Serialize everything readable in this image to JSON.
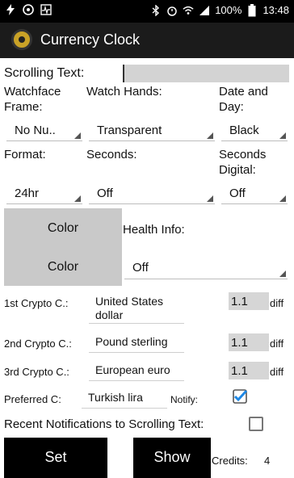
{
  "statusbar": {
    "battery": "100%",
    "time": "13:48",
    "icons": [
      "bolt-icon",
      "whatsapp-icon",
      "activity-icon",
      "bluetooth-icon",
      "alarm-icon",
      "wifi-icon",
      "signal-icon",
      "battery-icon"
    ]
  },
  "appbar": {
    "title": "Currency Clock"
  },
  "scrolling": {
    "label": "Scrolling Text:",
    "value": ""
  },
  "watchface": {
    "label_line1": "Watchface",
    "label_line2": "Frame:",
    "value": "No Nu.."
  },
  "hands": {
    "label": "Watch Hands:",
    "value": "Transparent"
  },
  "dateday": {
    "label_line1": "Date and",
    "label_line2": "Day:",
    "value": "Black"
  },
  "format": {
    "label": "Format:",
    "value": "24hr"
  },
  "seconds": {
    "label": "Seconds:",
    "value": "Off"
  },
  "seconds_digital": {
    "label_line1": "Seconds",
    "label_line2": "Digital:",
    "value": "Off"
  },
  "color": {
    "label1": "Color",
    "label2": "Color"
  },
  "health": {
    "label": "Health Info:",
    "value": "Off"
  },
  "crypto": [
    {
      "label": "1st Crypto C.:",
      "currency_line1": "United States",
      "currency_line2": "dollar",
      "diff_value": "1.1",
      "diff_label": "diff"
    },
    {
      "label": "2nd Crypto C.:",
      "currency_line1": "Pound sterling",
      "currency_line2": "",
      "diff_value": "1.1",
      "diff_label": "diff"
    },
    {
      "label": "3rd Crypto C.:",
      "currency_line1": "European euro",
      "currency_line2": "",
      "diff_value": "1.1",
      "diff_label": "diff"
    }
  ],
  "preferred": {
    "label": "Preferred C:",
    "value": "Turkish lira",
    "notify_label": "Notify:",
    "notify_checked": true
  },
  "recent": {
    "label": "Recent Notifications to Scrolling Text:",
    "checked": false
  },
  "buttons": {
    "set": "Set",
    "show": "Show"
  },
  "credits": {
    "label": "Credits:",
    "value": "4"
  },
  "colors": {
    "accent": "#1e88e5",
    "appbar": "#1b1b1b"
  }
}
